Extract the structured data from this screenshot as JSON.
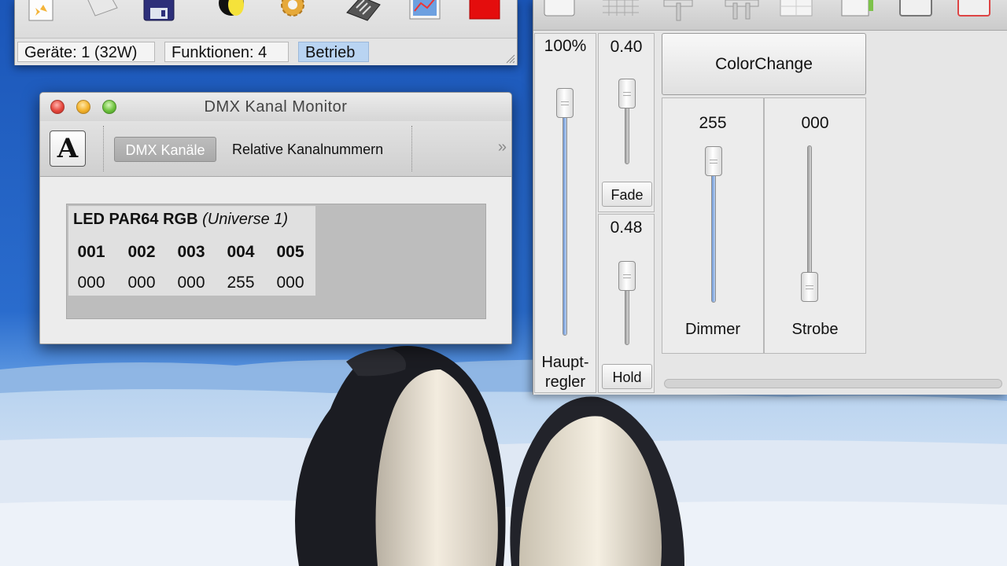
{
  "main_window": {
    "status": {
      "devices": "Geräte: 1 (32W)",
      "functions": "Funktionen: 4",
      "mode": "Betrieb"
    },
    "toolbar_icons": [
      "new-function-icon",
      "open-icon",
      "save-icon",
      "spotlight-icon",
      "gear-icon",
      "dmx-console-icon",
      "monitor-icon",
      "blackout-icon"
    ],
    "accent": "#b9d4f2"
  },
  "dmx_monitor": {
    "title": "DMX Kanal Monitor",
    "font_button": "A",
    "tabs": {
      "dmx_channels": "DMX Kanäle",
      "relative_numbers": "Relative Kanalnummern"
    },
    "overflow": "»",
    "fixture": {
      "name": "LED PAR64 RGB",
      "universe": "(Universe 1)",
      "channels": [
        {
          "number": "001",
          "value": "000"
        },
        {
          "number": "002",
          "value": "000"
        },
        {
          "number": "003",
          "value": "000"
        },
        {
          "number": "004",
          "value": "255"
        },
        {
          "number": "005",
          "value": "000"
        }
      ]
    }
  },
  "faders": {
    "master": {
      "value": "100%",
      "label": "Haupt-\nregler",
      "level": 1.0
    },
    "fade": {
      "value": "0.40",
      "button": "Fade",
      "level": 1.0
    },
    "hold": {
      "value": "0.48",
      "button": "Hold",
      "level": 1.0
    },
    "function_button": "ColorChange",
    "dimmer": {
      "value": "255",
      "label": "Dimmer",
      "level": 1.0
    },
    "strobe": {
      "value": "000",
      "label": "Strobe",
      "level": 0.0
    }
  }
}
